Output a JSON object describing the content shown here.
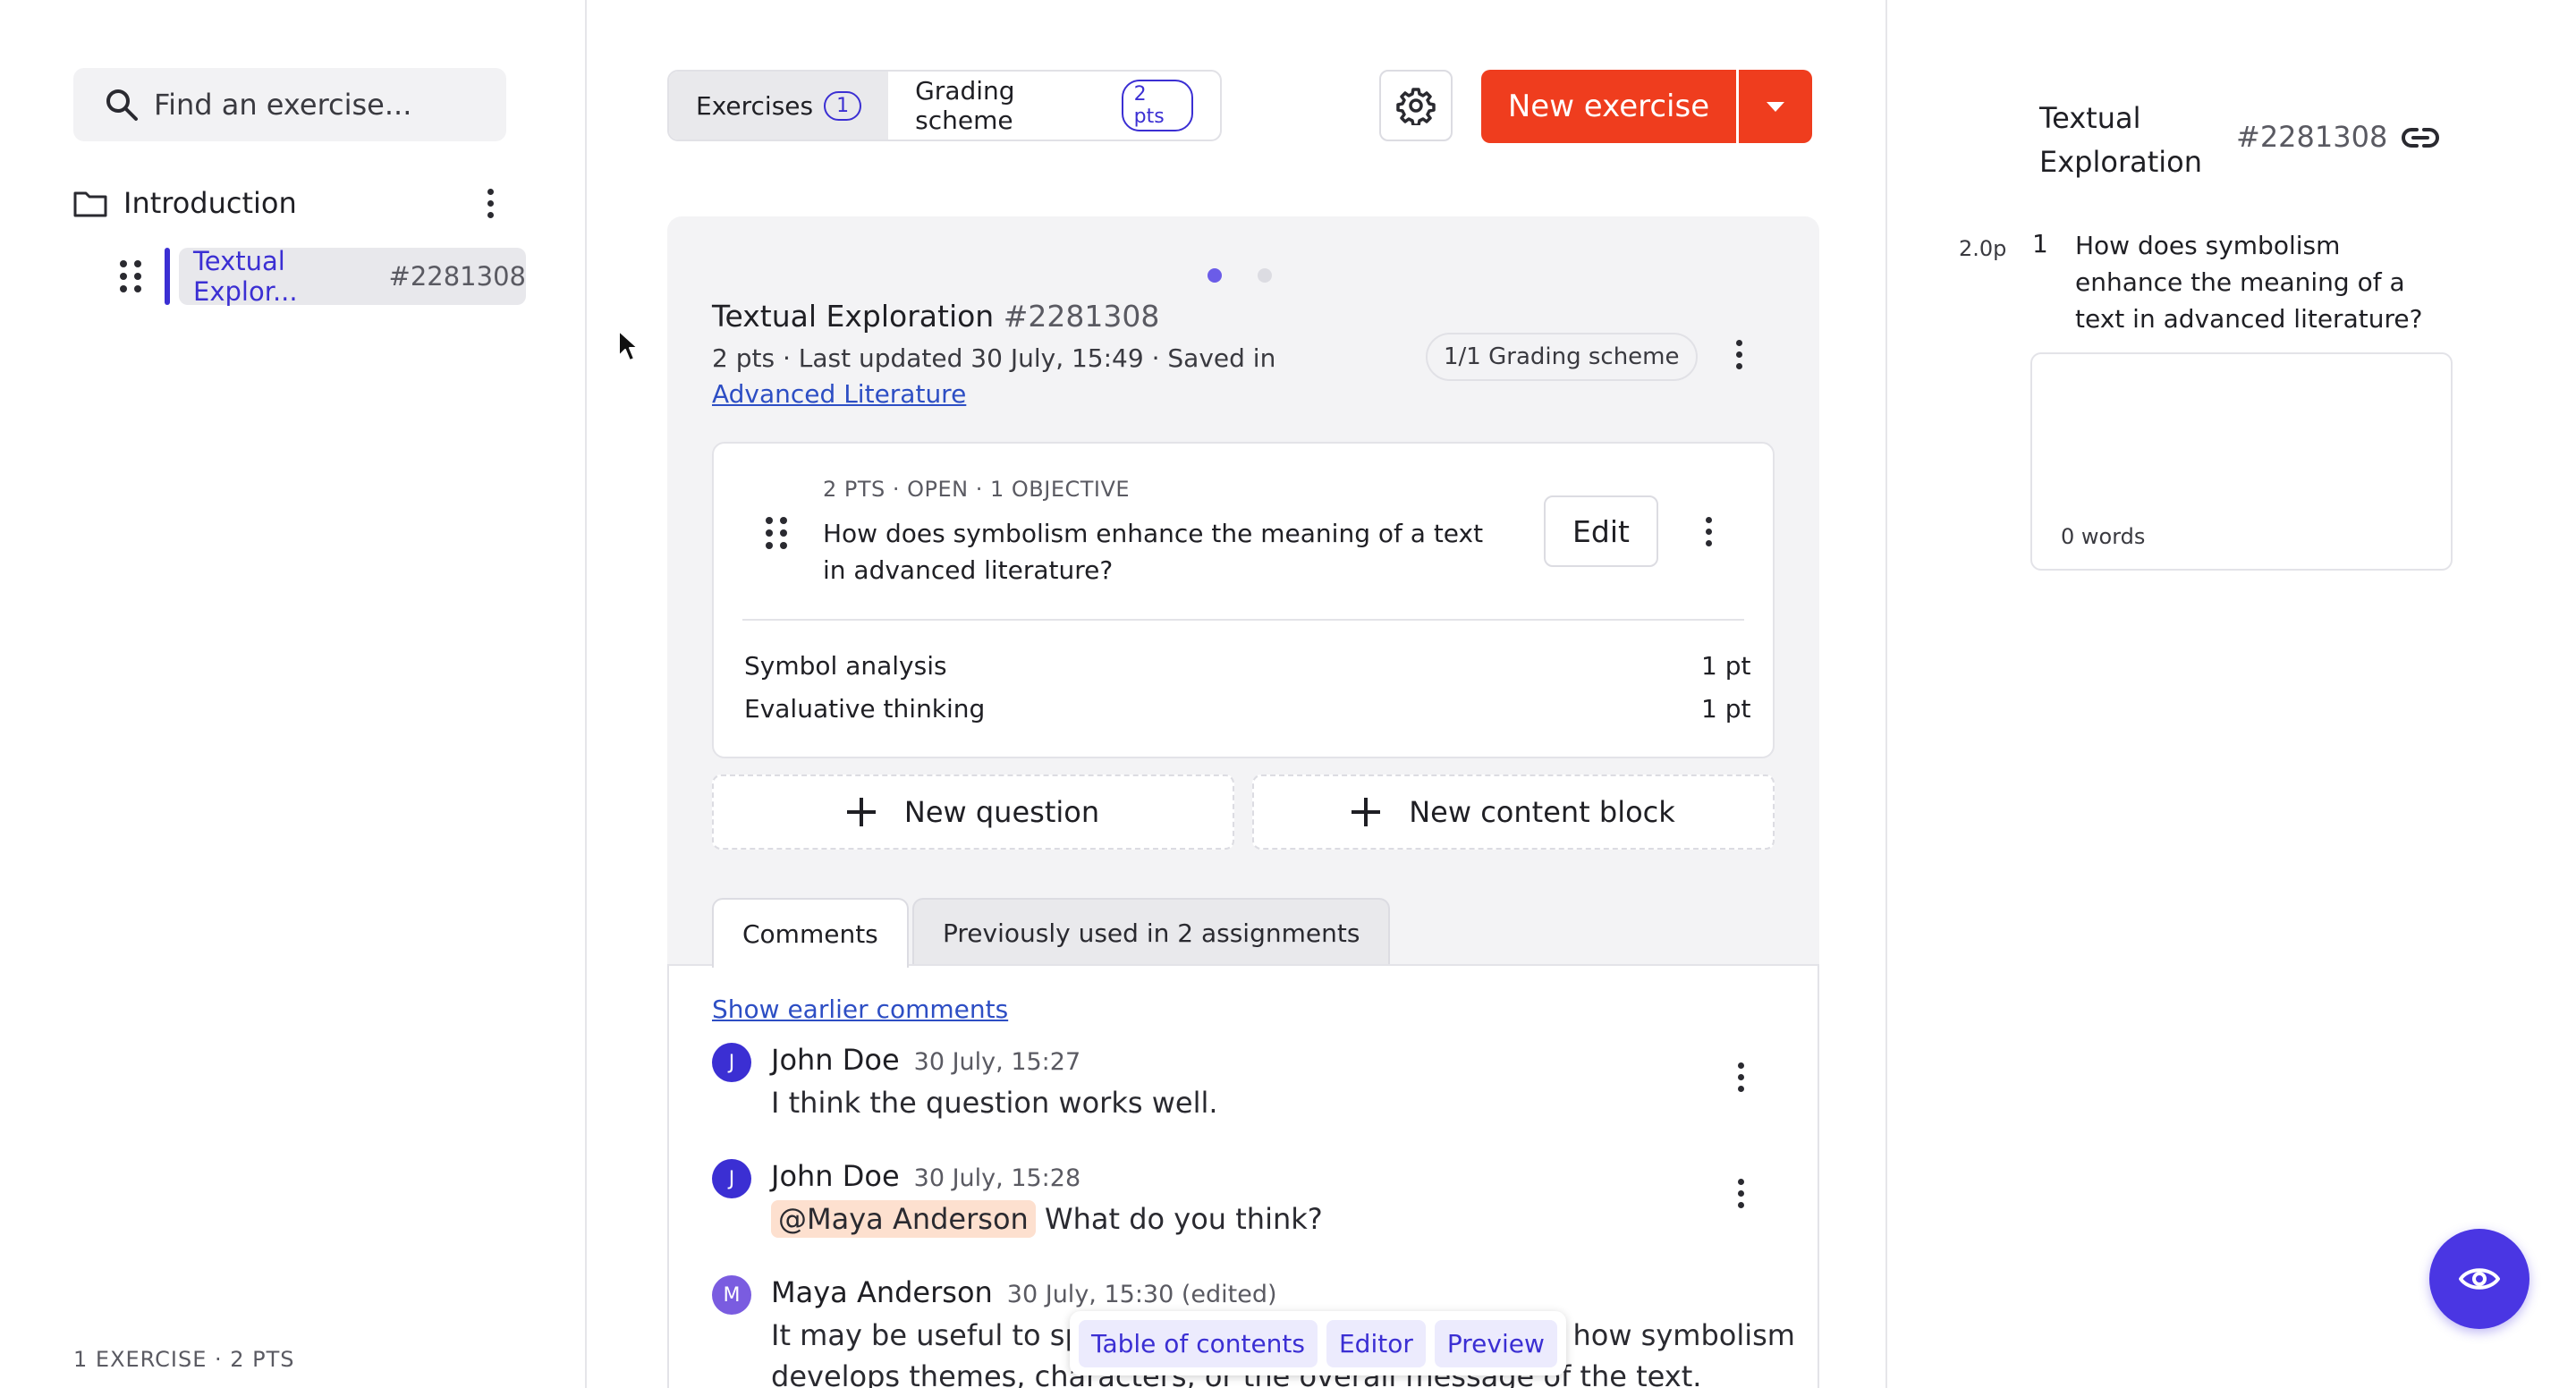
{
  "sidebar": {
    "search_placeholder": "Find an exercise...",
    "folder_label": "Introduction",
    "item_title": "Textual Explor...",
    "item_id": "#2281308",
    "footer": "1 EXERCISE · 2 PTS"
  },
  "toolbar": {
    "tab_exercises": "Exercises",
    "tab_exercises_count": "1",
    "tab_grading": "Grading scheme",
    "tab_grading_badge": "2 pts",
    "new_exercise_label": "New exercise"
  },
  "exercise": {
    "title": "Textual Exploration",
    "id": "#2281308",
    "meta": "2 pts · Last updated 30 July, 15:49 · Saved in",
    "saved_in_link": "Advanced Literature",
    "grading_pill": "1/1 Grading scheme",
    "question": {
      "meta": "2 PTS · OPEN · 1 OBJECTIVE",
      "text": "How does symbolism enhance the meaning of a text in advanced literature?",
      "edit_label": "Edit",
      "criteria": [
        {
          "label": "Symbol analysis",
          "points": "1 pt"
        },
        {
          "label": "Evaluative thinking",
          "points": "1 pt"
        }
      ]
    },
    "new_question_label": "New question",
    "new_content_block_label": "New content block"
  },
  "comments": {
    "tab_comments": "Comments",
    "tab_previously_used": "Previously used in 2 assignments",
    "show_earlier": "Show earlier comments",
    "items": [
      {
        "initial": "J",
        "name": "John Doe",
        "time": "30 July, 15:27",
        "mention": "",
        "text": "I think the question works well."
      },
      {
        "initial": "J",
        "name": "John Doe",
        "time": "30 July, 15:28",
        "mention": "@Maya Anderson",
        "text": "What do you think?"
      },
      {
        "initial": "M",
        "name": "Maya Anderson",
        "time": "30 July, 15:30 (edited)",
        "mention": "",
        "text_start": "It may be useful to spe",
        "text_end": "n how symbolism",
        "text_line2": "develops themes, characters, or the overall message of the text."
      }
    ]
  },
  "floating_menu": {
    "toc": "Table of contents",
    "editor": "Editor",
    "preview": "Preview"
  },
  "preview_panel": {
    "title": "Textual Exploration",
    "id": "#2281308",
    "points": "2.0p",
    "number": "1",
    "question": "How does symbolism enhance the meaning of a text in advanced literature?",
    "word_count": "0 words"
  },
  "colors": {
    "accent": "#3b2fd3",
    "primary_button": "#ef3d1e",
    "fab": "#4a36e3",
    "mention_bg": "#fde0cf"
  }
}
